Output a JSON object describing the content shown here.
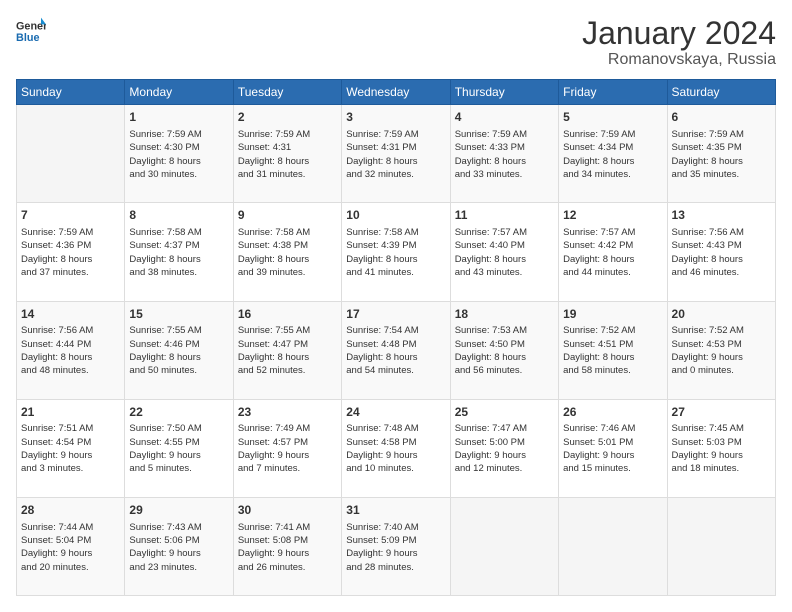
{
  "header": {
    "logo_line1": "General",
    "logo_line2": "Blue",
    "title": "January 2024",
    "subtitle": "Romanovskaya, Russia"
  },
  "weekdays": [
    "Sunday",
    "Monday",
    "Tuesday",
    "Wednesday",
    "Thursday",
    "Friday",
    "Saturday"
  ],
  "weeks": [
    [
      {
        "day": "",
        "sunrise": "",
        "sunset": "",
        "daylight": ""
      },
      {
        "day": "1",
        "sunrise": "Sunrise: 7:59 AM",
        "sunset": "Sunset: 4:30 PM",
        "daylight": "Daylight: 8 hours and 30 minutes."
      },
      {
        "day": "2",
        "sunrise": "Sunrise: 7:59 AM",
        "sunset": "Sunset: 4:31",
        "daylight": "Daylight: 8 hours and 31 minutes."
      },
      {
        "day": "3",
        "sunrise": "Sunrise: 7:59 AM",
        "sunset": "Sunset: 4:31 PM",
        "daylight": "Daylight: 8 hours and 32 minutes."
      },
      {
        "day": "4",
        "sunrise": "Sunrise: 7:59 AM",
        "sunset": "Sunset: 4:33 PM",
        "daylight": "Daylight: 8 hours and 33 minutes."
      },
      {
        "day": "5",
        "sunrise": "Sunrise: 7:59 AM",
        "sunset": "Sunset: 4:34 PM",
        "daylight": "Daylight: 8 hours and 34 minutes."
      },
      {
        "day": "6",
        "sunrise": "Sunrise: 7:59 AM",
        "sunset": "Sunset: 4:35 PM",
        "daylight": "Daylight: 8 hours and 35 minutes."
      }
    ],
    [
      {
        "day": "7",
        "sunrise": "Sunrise: 7:59 AM",
        "sunset": "Sunset: 4:36 PM",
        "daylight": "Daylight: 8 hours and 37 minutes."
      },
      {
        "day": "8",
        "sunrise": "Sunrise: 7:58 AM",
        "sunset": "Sunset: 4:37 PM",
        "daylight": "Daylight: 8 hours and 38 minutes."
      },
      {
        "day": "9",
        "sunrise": "Sunrise: 7:58 AM",
        "sunset": "Sunset: 4:38 PM",
        "daylight": "Daylight: 8 hours and 39 minutes."
      },
      {
        "day": "10",
        "sunrise": "Sunrise: 7:58 AM",
        "sunset": "Sunset: 4:39 PM",
        "daylight": "Daylight: 8 hours and 41 minutes."
      },
      {
        "day": "11",
        "sunrise": "Sunrise: 7:57 AM",
        "sunset": "Sunset: 4:40 PM",
        "daylight": "Daylight: 8 hours and 43 minutes."
      },
      {
        "day": "12",
        "sunrise": "Sunrise: 7:57 AM",
        "sunset": "Sunset: 4:42 PM",
        "daylight": "Daylight: 8 hours and 44 minutes."
      },
      {
        "day": "13",
        "sunrise": "Sunrise: 7:56 AM",
        "sunset": "Sunset: 4:43 PM",
        "daylight": "Daylight: 8 hours and 46 minutes."
      }
    ],
    [
      {
        "day": "14",
        "sunrise": "Sunrise: 7:56 AM",
        "sunset": "Sunset: 4:44 PM",
        "daylight": "Daylight: 8 hours and 48 minutes."
      },
      {
        "day": "15",
        "sunrise": "Sunrise: 7:55 AM",
        "sunset": "Sunset: 4:46 PM",
        "daylight": "Daylight: 8 hours and 50 minutes."
      },
      {
        "day": "16",
        "sunrise": "Sunrise: 7:55 AM",
        "sunset": "Sunset: 4:47 PM",
        "daylight": "Daylight: 8 hours and 52 minutes."
      },
      {
        "day": "17",
        "sunrise": "Sunrise: 7:54 AM",
        "sunset": "Sunset: 4:48 PM",
        "daylight": "Daylight: 8 hours and 54 minutes."
      },
      {
        "day": "18",
        "sunrise": "Sunrise: 7:53 AM",
        "sunset": "Sunset: 4:50 PM",
        "daylight": "Daylight: 8 hours and 56 minutes."
      },
      {
        "day": "19",
        "sunrise": "Sunrise: 7:52 AM",
        "sunset": "Sunset: 4:51 PM",
        "daylight": "Daylight: 8 hours and 58 minutes."
      },
      {
        "day": "20",
        "sunrise": "Sunrise: 7:52 AM",
        "sunset": "Sunset: 4:53 PM",
        "daylight": "Daylight: 9 hours and 0 minutes."
      }
    ],
    [
      {
        "day": "21",
        "sunrise": "Sunrise: 7:51 AM",
        "sunset": "Sunset: 4:54 PM",
        "daylight": "Daylight: 9 hours and 3 minutes."
      },
      {
        "day": "22",
        "sunrise": "Sunrise: 7:50 AM",
        "sunset": "Sunset: 4:55 PM",
        "daylight": "Daylight: 9 hours and 5 minutes."
      },
      {
        "day": "23",
        "sunrise": "Sunrise: 7:49 AM",
        "sunset": "Sunset: 4:57 PM",
        "daylight": "Daylight: 9 hours and 7 minutes."
      },
      {
        "day": "24",
        "sunrise": "Sunrise: 7:48 AM",
        "sunset": "Sunset: 4:58 PM",
        "daylight": "Daylight: 9 hours and 10 minutes."
      },
      {
        "day": "25",
        "sunrise": "Sunrise: 7:47 AM",
        "sunset": "Sunset: 5:00 PM",
        "daylight": "Daylight: 9 hours and 12 minutes."
      },
      {
        "day": "26",
        "sunrise": "Sunrise: 7:46 AM",
        "sunset": "Sunset: 5:01 PM",
        "daylight": "Daylight: 9 hours and 15 minutes."
      },
      {
        "day": "27",
        "sunrise": "Sunrise: 7:45 AM",
        "sunset": "Sunset: 5:03 PM",
        "daylight": "Daylight: 9 hours and 18 minutes."
      }
    ],
    [
      {
        "day": "28",
        "sunrise": "Sunrise: 7:44 AM",
        "sunset": "Sunset: 5:04 PM",
        "daylight": "Daylight: 9 hours and 20 minutes."
      },
      {
        "day": "29",
        "sunrise": "Sunrise: 7:43 AM",
        "sunset": "Sunset: 5:06 PM",
        "daylight": "Daylight: 9 hours and 23 minutes."
      },
      {
        "day": "30",
        "sunrise": "Sunrise: 7:41 AM",
        "sunset": "Sunset: 5:08 PM",
        "daylight": "Daylight: 9 hours and 26 minutes."
      },
      {
        "day": "31",
        "sunrise": "Sunrise: 7:40 AM",
        "sunset": "Sunset: 5:09 PM",
        "daylight": "Daylight: 9 hours and 28 minutes."
      },
      {
        "day": "",
        "sunrise": "",
        "sunset": "",
        "daylight": ""
      },
      {
        "day": "",
        "sunrise": "",
        "sunset": "",
        "daylight": ""
      },
      {
        "day": "",
        "sunrise": "",
        "sunset": "",
        "daylight": ""
      }
    ]
  ]
}
